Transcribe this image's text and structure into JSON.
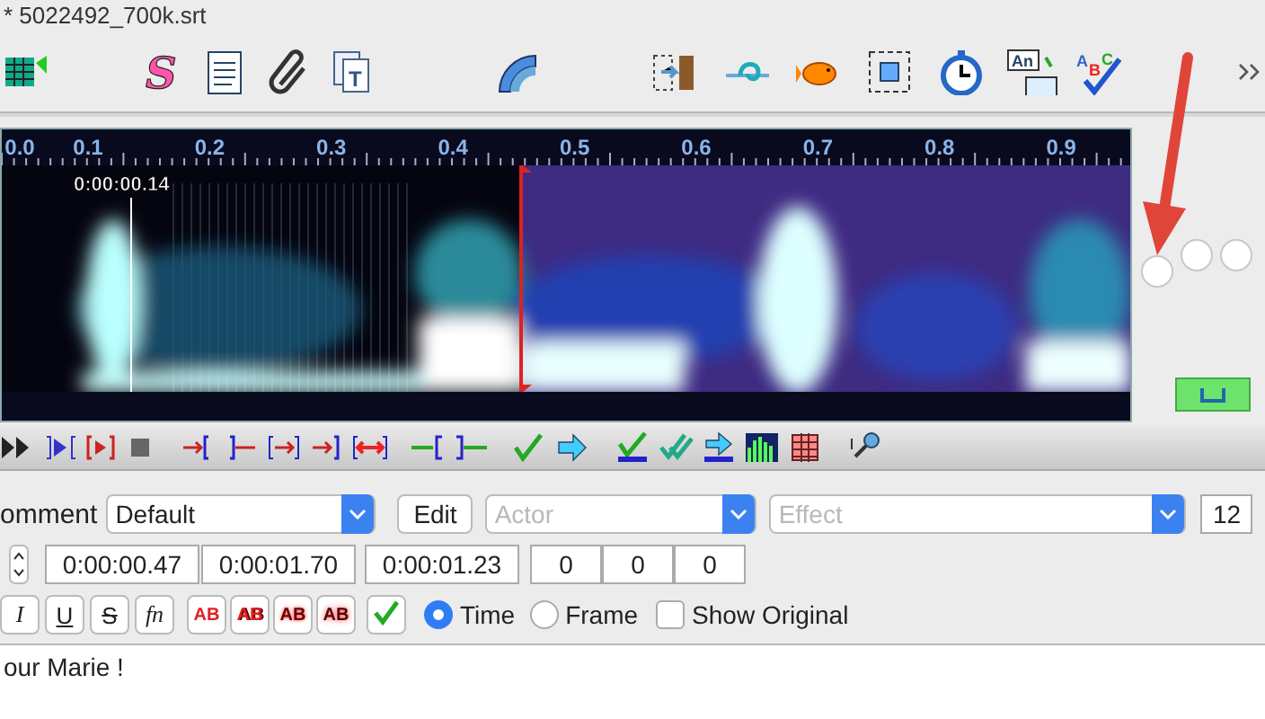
{
  "window": {
    "title": "* 5022492_700k.srt"
  },
  "toolbar": {
    "icon_letters": [
      "S",
      "T",
      "An",
      "A",
      "B",
      "C"
    ]
  },
  "waveform": {
    "ruler_labels": [
      "0.0",
      "0.1",
      "0.2",
      "0.3",
      "0.4",
      "0.5",
      "0.6",
      "0.7",
      "0.8",
      "0.9"
    ],
    "time_label": "0:00:00.14"
  },
  "editor": {
    "comment_label": "omment",
    "style": {
      "value": "Default"
    },
    "edit_button": "Edit",
    "actor": {
      "placeholder": "Actor"
    },
    "effect": {
      "placeholder": "Effect"
    },
    "layer": "12",
    "times": [
      "0:00:00.47",
      "0:00:01.70",
      "0:00:01.23"
    ],
    "margins": [
      "0",
      "0",
      "0"
    ],
    "format_buttons": [
      "I",
      "U",
      "S",
      "fn"
    ],
    "color_buttons": [
      "AB",
      "AB",
      "AB",
      "AB"
    ],
    "modes": [
      {
        "label": "Time",
        "selected": true
      },
      {
        "label": "Frame",
        "selected": false
      }
    ],
    "show_original": {
      "label": "Show Original",
      "checked": false
    },
    "text": "our Marie !"
  }
}
